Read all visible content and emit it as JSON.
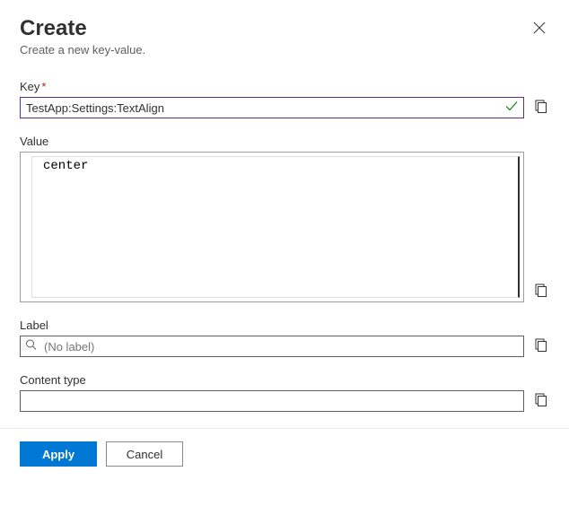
{
  "header": {
    "title": "Create",
    "subtitle": "Create a new key-value."
  },
  "fields": {
    "key": {
      "label": "Key",
      "required_marker": "*",
      "value": "TestApp:Settings:TextAlign"
    },
    "value": {
      "label": "Value",
      "value": "center"
    },
    "label": {
      "label": "Label",
      "placeholder": "(No label)",
      "value": ""
    },
    "content_type": {
      "label": "Content type",
      "value": ""
    }
  },
  "footer": {
    "apply": "Apply",
    "cancel": "Cancel"
  }
}
